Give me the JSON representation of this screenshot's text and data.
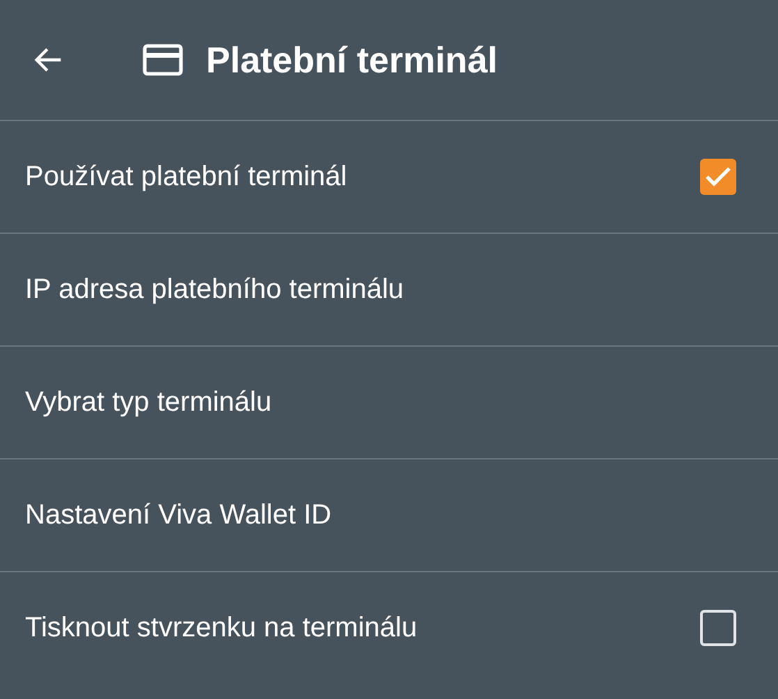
{
  "header": {
    "title": "Platební terminál"
  },
  "settings": [
    {
      "label": "Používat platební terminál",
      "kind": "checkbox",
      "checked": true
    },
    {
      "label": "IP adresa platebního terminálu",
      "kind": "plain"
    },
    {
      "label": "Vybrat typ terminálu",
      "kind": "plain"
    },
    {
      "label": "Nastavení Viva Wallet ID",
      "kind": "plain"
    },
    {
      "label": "Tisknout stvrzenku na terminálu",
      "kind": "checkbox",
      "checked": false
    }
  ]
}
